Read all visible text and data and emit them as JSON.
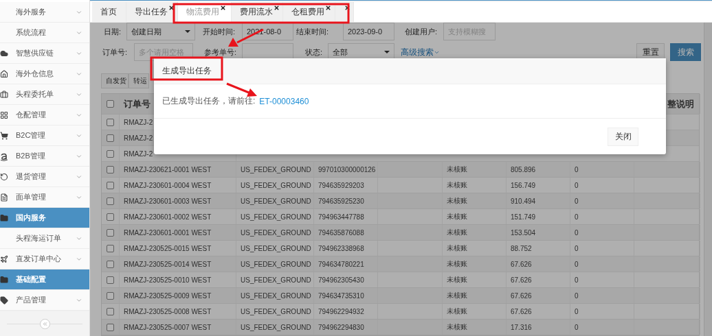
{
  "sidebar": {
    "items": [
      {
        "label": "海外服务",
        "selected": false
      },
      {
        "label": "系统流程",
        "selected": false
      },
      {
        "label": "智慧供应链",
        "selected": false
      },
      {
        "label": "海外仓信息",
        "selected": false
      },
      {
        "label": "头程委托单",
        "selected": false
      },
      {
        "label": "仓配管理",
        "selected": false
      },
      {
        "label": "B2C管理",
        "selected": false
      },
      {
        "label": "B2B管理",
        "selected": false
      },
      {
        "label": "退货管理",
        "selected": false
      },
      {
        "label": "面单管理",
        "selected": false
      },
      {
        "label": "国内服务",
        "selected": true
      },
      {
        "label": "头程海运订单",
        "selected": false
      },
      {
        "label": "直发订单中心",
        "selected": false
      },
      {
        "label": "基础配置",
        "selected": true
      },
      {
        "label": "产品管理",
        "selected": false
      }
    ]
  },
  "tabs": [
    {
      "label": "首页",
      "selected": false,
      "closable": false
    },
    {
      "label": "导出任务",
      "selected": false,
      "closable": true
    },
    {
      "label": "物流费用",
      "selected": true,
      "closable": true
    },
    {
      "label": "费用流水",
      "selected": false,
      "closable": true
    },
    {
      "label": "仓租费用",
      "selected": false,
      "closable": true
    },
    {
      "selected": false,
      "closable": true
    }
  ],
  "filters": [
    [
      {
        "label": "日期:",
        "kind": "select",
        "value": "创建日期"
      },
      {
        "label": "开始时间:",
        "kind": "input",
        "value": "2021-08-0"
      },
      {
        "label": "结束时间:",
        "kind": "input",
        "value": "2023-09-0"
      },
      {
        "label": "创建用户:",
        "kind": "input",
        "placeholder": "支持模糊搜"
      }
    ],
    [
      {
        "label": "订单号:",
        "kind": "input",
        "placeholder": "多个请用空格"
      },
      {
        "label": "参考单号:",
        "kind": "input"
      },
      {
        "label": "状态:",
        "kind": "select",
        "value": "全部"
      }
    ]
  ],
  "advanced_search": "高级搜索",
  "buttons": [
    {
      "label": "重置",
      "kind": "default"
    },
    {
      "label": "搜索",
      "kind": "primary"
    }
  ],
  "subtabs": [
    "自发货",
    "转运"
  ],
  "table": {
    "header": {
      "checked": false,
      "column_1": "订单号",
      "column_8": "整说明"
    },
    "partial_rows": [
      {
        "checked": false,
        "text": "RMAZJ-2"
      },
      {
        "checked": false,
        "text": "RMAZJ-2"
      },
      {
        "checked": false,
        "text": "RMAZJ-2"
      }
    ],
    "rows": [
      {
        "checked": false,
        "cells": [
          "RMAZJ-230621-0001 WEST",
          "US_FEDEX_GROUND",
          "997010300000126",
          "",
          "未核账",
          "805.896",
          "0",
          ""
        ]
      },
      {
        "checked": false,
        "cells": [
          "RMAZJ-230601-0004 WEST",
          "US_FEDEX_GROUND",
          "794635929203",
          "",
          "未核账",
          "156.749",
          "0",
          ""
        ]
      },
      {
        "checked": false,
        "cells": [
          "RMAZJ-230601-0003 WEST",
          "US_FEDEX_GROUND",
          "794635925230",
          "",
          "未核账",
          "910.494",
          "0",
          ""
        ]
      },
      {
        "checked": false,
        "cells": [
          "RMAZJ-230601-0002 WEST",
          "US_FEDEX_GROUND",
          "794963447788",
          "",
          "未核账",
          "151.749",
          "0",
          ""
        ]
      },
      {
        "checked": false,
        "cells": [
          "RMAZJ-230601-0001 WEST",
          "US_FEDEX_GROUND",
          "794635876088",
          "",
          "未核账",
          "153.504",
          "0",
          ""
        ]
      },
      {
        "checked": false,
        "cells": [
          "RMAZJ-230525-0015 WEST",
          "US_FEDEX_GROUND",
          "794962338968",
          "",
          "未核账",
          "88.752",
          "0",
          ""
        ]
      },
      {
        "checked": false,
        "cells": [
          "RMAZJ-230525-0014 WEST",
          "US_FEDEX_GROUND",
          "794634780221",
          "",
          "未核账",
          "67.626",
          "0",
          ""
        ]
      },
      {
        "checked": false,
        "cells": [
          "RMAZJ-230525-0010 WEST",
          "US_FEDEX_GROUND",
          "794962305430",
          "",
          "未核账",
          "67.626",
          "0",
          ""
        ]
      },
      {
        "checked": false,
        "cells": [
          "RMAZJ-230525-0009 WEST",
          "US_FEDEX_GROUND",
          "794634735310",
          "",
          "未核账",
          "67.626",
          "0",
          ""
        ]
      },
      {
        "checked": false,
        "cells": [
          "RMAZJ-230525-0008 WEST",
          "US_FEDEX_GROUND",
          "794962294932",
          "",
          "未核账",
          "67.626",
          "0",
          ""
        ]
      },
      {
        "checked": false,
        "cells": [
          "RMAZJ-230525-0007 WEST",
          "US_FEDEX_GROUND",
          "794962294830",
          "",
          "未核账",
          "17.316",
          "0",
          ""
        ]
      }
    ]
  },
  "dialog": {
    "title": "生成导出任务",
    "message": "已生成导出任务，请前往:",
    "link": "ET-00003460",
    "buttons": [
      "关闭"
    ]
  }
}
